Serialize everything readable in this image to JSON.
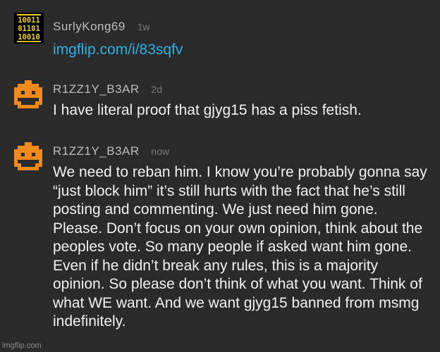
{
  "comments": [
    {
      "username": "SurlyKong69",
      "time": "1w",
      "text": "imgflip.com/i/83sqfv",
      "avatar_icon": "binary-avatar-icon",
      "avatar_rows": [
        "10011",
        "01101",
        "10010"
      ]
    },
    {
      "username": "R1ZZ1Y_B3AR",
      "time": "2d",
      "text": "I have literal proof that gjyg15 has a piss fetish.",
      "avatar_icon": "orange-pixel-face-icon"
    },
    {
      "username": "R1ZZ1Y_B3AR",
      "time": "now",
      "text": "We need to reban him. I know you’re probably gonna say “just block him” it’s still hurts with the fact that he’s still posting and commenting. We just need him gone. Please. Don’t focus on your own opinion, think about the peoples vote. So many people if asked want him gone. Even if he didn’t break any rules, this is a majority opinion. So please don’t think of what you want. Think of what WE want. And we want gjyg15 banned from msmg indefinitely.",
      "avatar_icon": "orange-pixel-face-icon"
    }
  ],
  "watermark": "imgflip.com",
  "colors": {
    "background": "#2a2a2a",
    "link": "#2fb0e8",
    "avatar_orange": "#f08a1c",
    "avatar_yellow": "#f2d21b"
  }
}
